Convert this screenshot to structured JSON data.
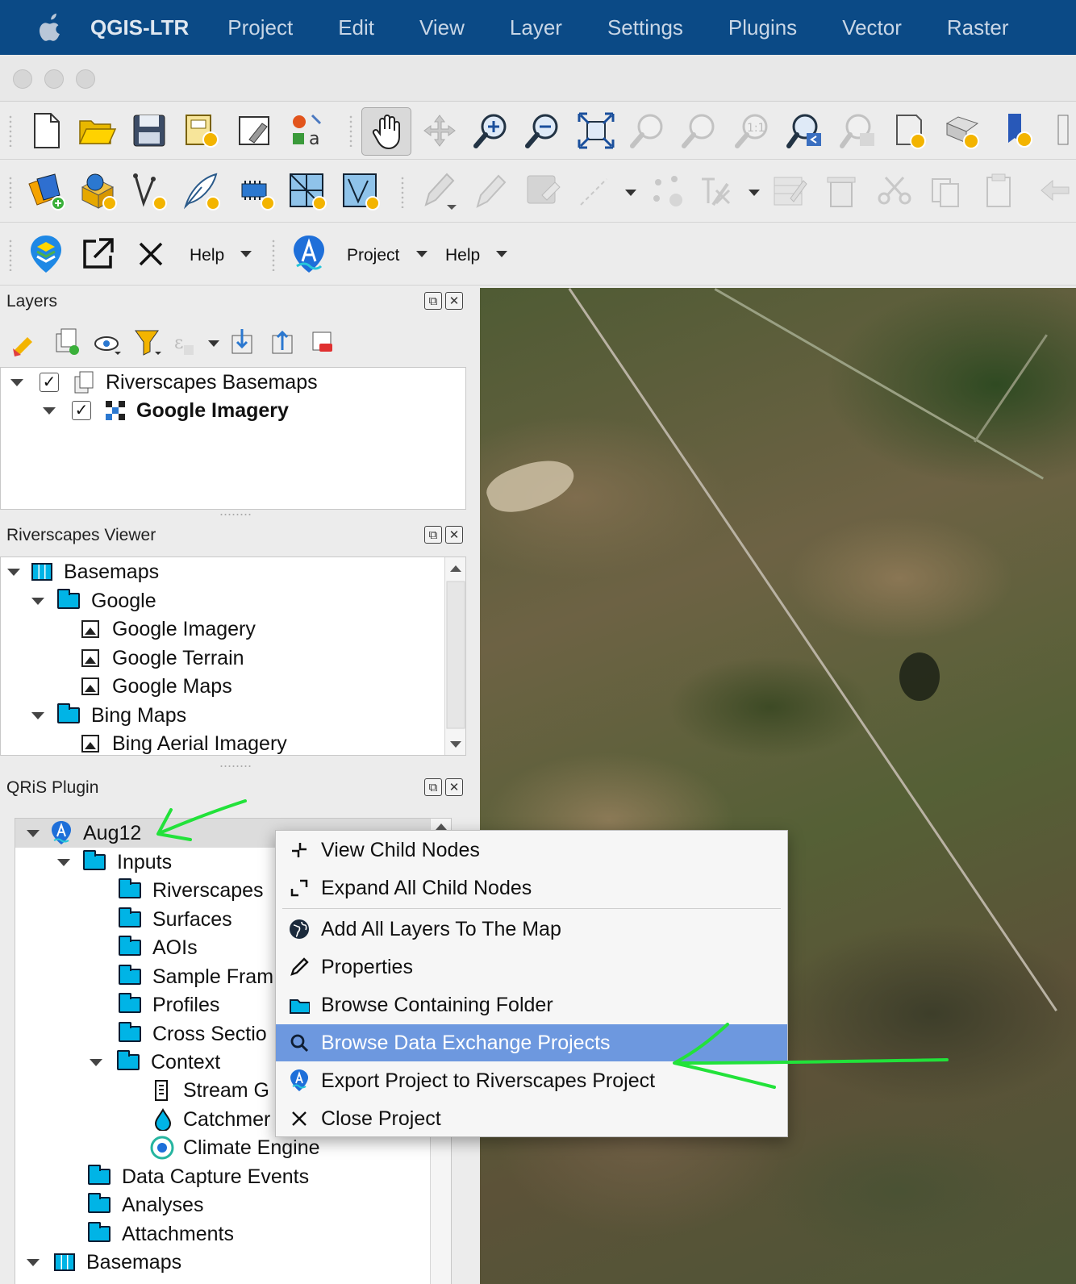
{
  "menubar": {
    "app_name": "QGIS-LTR",
    "items": [
      "Project",
      "Edit",
      "View",
      "Layer",
      "Settings",
      "Plugins",
      "Vector",
      "Raster"
    ]
  },
  "toolbar3": {
    "help1": "Help",
    "project": "Project",
    "help2": "Help"
  },
  "layers_panel": {
    "title": "Layers",
    "items": [
      {
        "label": "Riverscapes Basemaps",
        "checked": true
      },
      {
        "label": "Google Imagery",
        "checked": true
      }
    ]
  },
  "viewer_panel": {
    "title": "Riverscapes Viewer",
    "items": [
      "Basemaps",
      "Google",
      "Google Imagery",
      "Google Terrain",
      "Google Maps",
      "Bing Maps",
      "Bing Aerial Imagery"
    ]
  },
  "qris_panel": {
    "title": "QRiS Plugin",
    "items": [
      "Aug12",
      "Inputs",
      "Riverscapes",
      "Surfaces",
      "AOIs",
      "Sample Fram",
      "Profiles",
      "Cross Sectio",
      "Context",
      "Stream G",
      "Catchmer",
      "Climate Engine",
      "Data Capture Events",
      "Analyses",
      "Attachments",
      "Basemaps"
    ]
  },
  "context_menu": {
    "items": [
      {
        "label": "View Child Nodes",
        "icon": "collapse-icon"
      },
      {
        "label": "Expand All Child Nodes",
        "icon": "expand-icon"
      },
      {
        "label": "Add All Layers To The Map",
        "icon": "globe-icon"
      },
      {
        "label": "Properties",
        "icon": "pencil-icon"
      },
      {
        "label": "Browse Containing Folder",
        "icon": "folder-icon"
      },
      {
        "label": "Browse Data Exchange Projects",
        "icon": "search-icon",
        "highlighted": true
      },
      {
        "label": "Export Project to Riverscapes Project",
        "icon": "riverscapes-icon"
      },
      {
        "label": "Close Project",
        "icon": "close-icon"
      }
    ]
  },
  "colors": {
    "menubar": "#0b4a86",
    "highlight": "#6d98df",
    "folder": "#00b4e6",
    "annotation_arrow": "#22e23a"
  }
}
